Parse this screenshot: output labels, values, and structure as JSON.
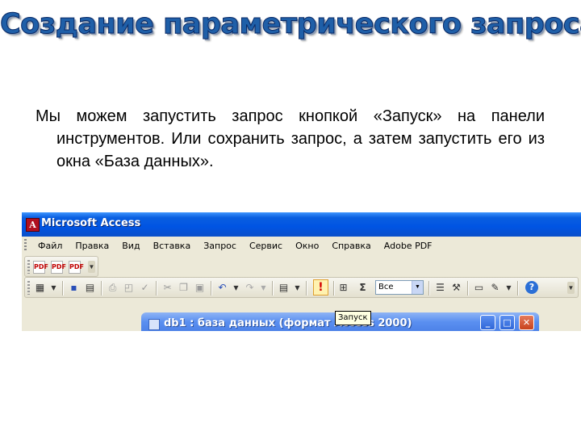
{
  "slide": {
    "title": "Создание параметрического запроса",
    "body": "Мы можем запустить запрос кнопкой «Запуск» на панели инструментов. Или сохранить запрос, а затем запустить его из окна «База данных»."
  },
  "app": {
    "title": "Microsoft Access",
    "menu": [
      "Файл",
      "Правка",
      "Вид",
      "Вставка",
      "Запрос",
      "Сервис",
      "Окно",
      "Справка",
      "Adobe PDF"
    ],
    "toolbar": {
      "filter_value": "Все",
      "run_tooltip": "Запуск",
      "icons": [
        "pdf-icon",
        "datasheet-view-icon",
        "save-icon",
        "print-icon",
        "cut-icon",
        "copy-icon",
        "paste-icon",
        "undo-icon",
        "redo-icon",
        "query-type-icon",
        "run-icon",
        "show-table-icon",
        "totals-icon",
        "properties-icon",
        "builder-icon",
        "database-window-icon",
        "new-object-icon",
        "help-icon"
      ]
    },
    "db_window": {
      "title": "db1 : база данных (формат Access 2000)"
    }
  },
  "colors": {
    "title_fill": "#1f5fa8",
    "xp_titlebar": "#0054e3",
    "tooltip_bg": "#ffffe1",
    "run_icon": "#d40000"
  }
}
